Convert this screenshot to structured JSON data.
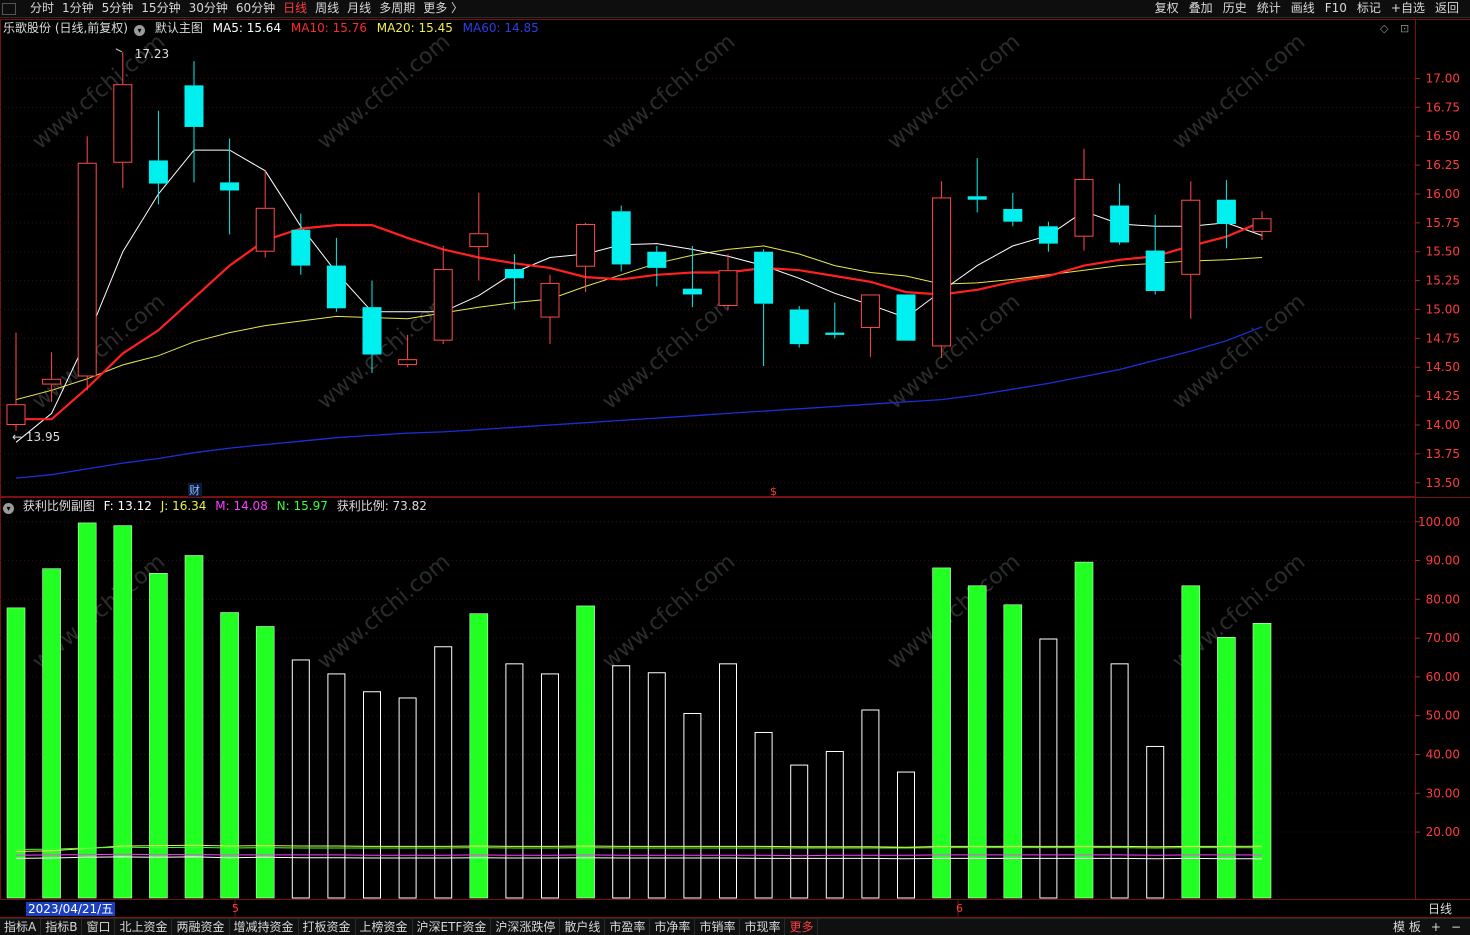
{
  "topbar": {
    "periods": [
      {
        "label": "分时",
        "active": false
      },
      {
        "label": "1分钟",
        "active": false
      },
      {
        "label": "5分钟",
        "active": false
      },
      {
        "label": "15分钟",
        "active": false
      },
      {
        "label": "30分钟",
        "active": false
      },
      {
        "label": "60分钟",
        "active": false
      },
      {
        "label": "日线",
        "active": true
      },
      {
        "label": "周线",
        "active": false
      },
      {
        "label": "月线",
        "active": false
      },
      {
        "label": "多周期",
        "active": false
      },
      {
        "label": "更多 〉",
        "active": false
      }
    ],
    "tools": [
      "复权",
      "叠加",
      "历史",
      "统计",
      "画线",
      "F10",
      "标记",
      "+自选",
      "返回"
    ]
  },
  "main_panel": {
    "stock_title": "乐歌股份 (日线,前复权)",
    "template_label": "默认主图",
    "ma5": "MA5: 15.64",
    "ma10": "MA10: 15.76",
    "ma20": "MA20: 15.45",
    "ma60": "MA60: 14.85",
    "high_marker": "17.23",
    "low_marker": "13.95",
    "event_cai": "财",
    "event_dollar": "$",
    "corner_icons": [
      "◇",
      "⊡"
    ]
  },
  "sub_panel": {
    "title": "获利比例副图",
    "f": "F: 13.12",
    "j": "J: 16.34",
    "m": "M: 14.08",
    "n": "N: 15.97",
    "ratio": "获利比例: 73.82"
  },
  "bottom": {
    "date_badge": "2023/04/21/五",
    "month_marks": [
      "5",
      "6"
    ],
    "period_label": "日线",
    "tabs": [
      {
        "label": "指标A",
        "hot": false
      },
      {
        "label": "指标B",
        "hot": false
      },
      {
        "label": "窗口",
        "hot": false
      },
      {
        "label": "北上资金",
        "hot": false
      },
      {
        "label": "两融资金",
        "hot": false
      },
      {
        "label": "增减持资金",
        "hot": false
      },
      {
        "label": "打板资金",
        "hot": false
      },
      {
        "label": "上榜资金",
        "hot": false
      },
      {
        "label": "沪深ETF资金",
        "hot": false
      },
      {
        "label": "沪深涨跌停",
        "hot": false
      },
      {
        "label": "散户线",
        "hot": false
      },
      {
        "label": "市盈率",
        "hot": false
      },
      {
        "label": "市净率",
        "hot": false
      },
      {
        "label": "市销率",
        "hot": false
      },
      {
        "label": "市现率",
        "hot": false
      },
      {
        "label": "更多",
        "hot": true
      }
    ],
    "right_tools": [
      "模 板",
      "+",
      "−"
    ]
  },
  "watermark": "www.cfchi.com",
  "colors": {
    "up": "#ff4a4a",
    "down": "#00f0f0",
    "ma5": "#ffffff",
    "ma10": "#ff2020",
    "ma20": "#e8e84a",
    "ma60": "#1c2fd6",
    "profit_high": "#22ff22",
    "profit_low": "#ffffff"
  },
  "chart_data": [
    {
      "type": "candlestick",
      "y_ticks": [
        17.0,
        16.75,
        16.5,
        16.25,
        16.0,
        15.75,
        15.5,
        15.25,
        15.0,
        14.75,
        14.5,
        14.25,
        14.0,
        13.75,
        13.5
      ],
      "ylim": [
        13.42,
        17.35
      ],
      "candles": [
        {
          "o": 14.0,
          "h": 14.8,
          "l": 13.95,
          "c": 14.18
        },
        {
          "o": 14.35,
          "h": 14.63,
          "l": 14.2,
          "c": 14.4
        },
        {
          "o": 14.42,
          "h": 16.5,
          "l": 14.3,
          "c": 16.27
        },
        {
          "o": 16.27,
          "h": 17.23,
          "l": 16.05,
          "c": 16.95
        },
        {
          "o": 16.29,
          "h": 16.72,
          "l": 15.91,
          "c": 16.09
        },
        {
          "o": 16.94,
          "h": 17.15,
          "l": 16.1,
          "c": 16.58
        },
        {
          "o": 16.1,
          "h": 16.48,
          "l": 15.65,
          "c": 16.03
        },
        {
          "o": 15.5,
          "h": 16.2,
          "l": 15.45,
          "c": 15.88
        },
        {
          "o": 15.69,
          "h": 15.83,
          "l": 15.3,
          "c": 15.38
        },
        {
          "o": 15.38,
          "h": 15.62,
          "l": 14.98,
          "c": 15.01
        },
        {
          "o": 15.02,
          "h": 15.25,
          "l": 14.45,
          "c": 14.61
        },
        {
          "o": 14.52,
          "h": 14.78,
          "l": 14.5,
          "c": 14.57
        },
        {
          "o": 14.73,
          "h": 15.55,
          "l": 14.7,
          "c": 15.35
        },
        {
          "o": 15.54,
          "h": 16.01,
          "l": 15.25,
          "c": 15.66
        },
        {
          "o": 15.35,
          "h": 15.48,
          "l": 15.0,
          "c": 15.27
        },
        {
          "o": 14.93,
          "h": 15.3,
          "l": 14.7,
          "c": 15.23
        },
        {
          "o": 15.37,
          "h": 15.75,
          "l": 15.15,
          "c": 15.74
        },
        {
          "o": 15.85,
          "h": 15.9,
          "l": 15.33,
          "c": 15.39
        },
        {
          "o": 15.5,
          "h": 15.55,
          "l": 15.2,
          "c": 15.36
        },
        {
          "o": 15.18,
          "h": 15.55,
          "l": 15.02,
          "c": 15.13
        },
        {
          "o": 15.03,
          "h": 15.48,
          "l": 15.0,
          "c": 15.34
        },
        {
          "o": 15.5,
          "h": 15.52,
          "l": 14.51,
          "c": 15.05
        },
        {
          "o": 15.0,
          "h": 15.03,
          "l": 14.67,
          "c": 14.7
        },
        {
          "o": 14.8,
          "h": 15.06,
          "l": 14.75,
          "c": 14.78
        },
        {
          "o": 14.84,
          "h": 15.13,
          "l": 14.59,
          "c": 15.13
        },
        {
          "o": 15.13,
          "h": 15.13,
          "l": 14.73,
          "c": 14.73
        },
        {
          "o": 14.68,
          "h": 16.11,
          "l": 14.58,
          "c": 15.97
        },
        {
          "o": 15.98,
          "h": 16.31,
          "l": 15.84,
          "c": 15.95
        },
        {
          "o": 15.87,
          "h": 16.01,
          "l": 15.72,
          "c": 15.76
        },
        {
          "o": 15.72,
          "h": 15.76,
          "l": 15.5,
          "c": 15.57
        },
        {
          "o": 15.63,
          "h": 16.39,
          "l": 15.51,
          "c": 16.13
        },
        {
          "o": 15.9,
          "h": 16.09,
          "l": 15.56,
          "c": 15.58
        },
        {
          "o": 15.51,
          "h": 15.82,
          "l": 15.13,
          "c": 15.16
        },
        {
          "o": 15.3,
          "h": 16.11,
          "l": 14.92,
          "c": 15.95
        },
        {
          "o": 15.95,
          "h": 16.12,
          "l": 15.53,
          "c": 15.74
        },
        {
          "o": 15.67,
          "h": 15.85,
          "l": 15.6,
          "c": 15.79
        }
      ],
      "ma5": [
        13.85,
        14.1,
        14.75,
        15.5,
        16.0,
        16.38,
        16.38,
        16.2,
        15.72,
        15.32,
        14.98,
        14.98,
        14.98,
        15.12,
        15.32,
        15.45,
        15.48,
        15.56,
        15.57,
        15.52,
        15.46,
        15.38,
        15.27,
        15.14,
        15.04,
        14.93,
        15.16,
        15.38,
        15.55,
        15.64,
        15.85,
        15.74,
        15.72,
        15.72,
        15.75,
        15.64
      ],
      "ma10": [
        14.05,
        14.05,
        14.32,
        14.62,
        14.82,
        15.1,
        15.38,
        15.6,
        15.7,
        15.73,
        15.73,
        15.62,
        15.52,
        15.45,
        15.4,
        15.36,
        15.28,
        15.26,
        15.3,
        15.32,
        15.32,
        15.36,
        15.34,
        15.29,
        15.24,
        15.15,
        15.13,
        15.17,
        15.24,
        15.29,
        15.38,
        15.43,
        15.46,
        15.55,
        15.63,
        15.76
      ],
      "ma20": [
        14.22,
        14.3,
        14.4,
        14.52,
        14.6,
        14.72,
        14.8,
        14.86,
        14.9,
        14.94,
        14.93,
        14.92,
        14.97,
        15.02,
        15.06,
        15.09,
        15.2,
        15.3,
        15.4,
        15.47,
        15.52,
        15.55,
        15.48,
        15.38,
        15.32,
        15.29,
        15.22,
        15.23,
        15.26,
        15.3,
        15.34,
        15.38,
        15.4,
        15.42,
        15.43,
        15.45
      ],
      "ma60": [
        13.54,
        13.57,
        13.62,
        13.67,
        13.71,
        13.76,
        13.8,
        13.83,
        13.86,
        13.89,
        13.91,
        13.93,
        13.94,
        13.96,
        13.98,
        14.0,
        14.02,
        14.04,
        14.06,
        14.08,
        14.1,
        14.12,
        14.14,
        14.16,
        14.18,
        14.2,
        14.22,
        14.26,
        14.31,
        14.36,
        14.42,
        14.48,
        14.56,
        14.64,
        14.73,
        14.85
      ]
    },
    {
      "type": "bar",
      "title": "获利比例",
      "y_ticks": [
        100,
        90,
        80,
        70,
        60,
        50,
        40,
        30,
        20
      ],
      "ylim": [
        3,
        102
      ],
      "threshold": 70,
      "values": [
        77.8,
        87.9,
        99.7,
        99.0,
        86.7,
        91.3,
        76.6,
        73.0,
        64.5,
        60.9,
        56.3,
        54.7,
        67.9,
        76.3,
        63.5,
        60.9,
        78.3,
        63.0,
        61.2,
        50.7,
        63.5,
        45.8,
        37.4,
        40.9,
        51.6,
        35.6,
        88.1,
        83.5,
        78.6,
        69.9,
        89.6,
        63.5,
        42.2,
        83.5,
        70.2,
        73.82
      ],
      "lines": {
        "F": [
          13.2,
          13.3,
          13.5,
          13.6,
          13.5,
          13.6,
          13.4,
          13.5,
          13.4,
          13.4,
          13.3,
          13.3,
          13.3,
          13.4,
          13.3,
          13.3,
          13.4,
          13.3,
          13.3,
          13.3,
          13.3,
          13.2,
          13.2,
          13.2,
          13.2,
          13.1,
          13.2,
          13.2,
          13.2,
          13.2,
          13.2,
          13.2,
          13.1,
          13.2,
          13.1,
          13.12
        ],
        "J": [
          15.0,
          15.2,
          15.8,
          16.4,
          16.5,
          16.6,
          16.4,
          16.5,
          16.4,
          16.4,
          16.3,
          16.3,
          16.3,
          16.4,
          16.3,
          16.3,
          16.4,
          16.3,
          16.3,
          16.3,
          16.3,
          16.3,
          16.2,
          16.2,
          16.2,
          16.1,
          16.3,
          16.3,
          16.3,
          16.3,
          16.3,
          16.3,
          16.2,
          16.3,
          16.3,
          16.34
        ],
        "M": [
          14.0,
          14.1,
          14.2,
          14.3,
          14.2,
          14.2,
          14.1,
          14.1,
          14.1,
          14.1,
          14.0,
          14.0,
          14.0,
          14.1,
          14.0,
          14.0,
          14.1,
          14.0,
          14.0,
          14.0,
          14.0,
          14.0,
          13.9,
          14.0,
          14.0,
          14.0,
          14.1,
          14.1,
          14.1,
          14.1,
          14.1,
          14.1,
          14.0,
          14.1,
          14.1,
          14.08
        ],
        "N": [
          15.5,
          15.6,
          15.9,
          16.1,
          16.0,
          16.1,
          15.9,
          16.0,
          15.9,
          15.9,
          15.9,
          15.9,
          15.9,
          16.0,
          15.9,
          15.9,
          16.0,
          15.9,
          15.9,
          15.9,
          15.9,
          15.9,
          15.9,
          15.9,
          15.9,
          15.9,
          16.0,
          16.0,
          16.0,
          16.0,
          16.0,
          16.0,
          15.9,
          16.0,
          16.0,
          15.97
        ]
      }
    }
  ]
}
